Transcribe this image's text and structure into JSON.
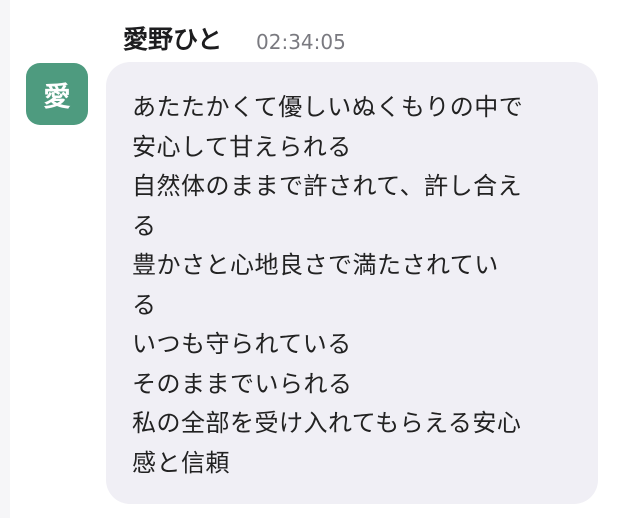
{
  "message": {
    "avatar_initial": "愛",
    "sender_name": "愛野ひと",
    "timestamp": "02:34:05",
    "lines": [
      "あたたかくて優しいぬくもりの中で",
      "安心して甘えられる",
      "自然体のままで許されて、許し合え",
      "る",
      "豊かさと心地良さで満たされてい",
      "る",
      "いつも守られている",
      "そのままでいられる",
      "私の全部を受け入れてもらえる安心",
      "感と信頼"
    ]
  },
  "colors": {
    "avatar_bg": "#4e9b7f",
    "bubble_bg": "#f0eff5",
    "timestamp": "#7a7a80",
    "text": "#222222"
  }
}
